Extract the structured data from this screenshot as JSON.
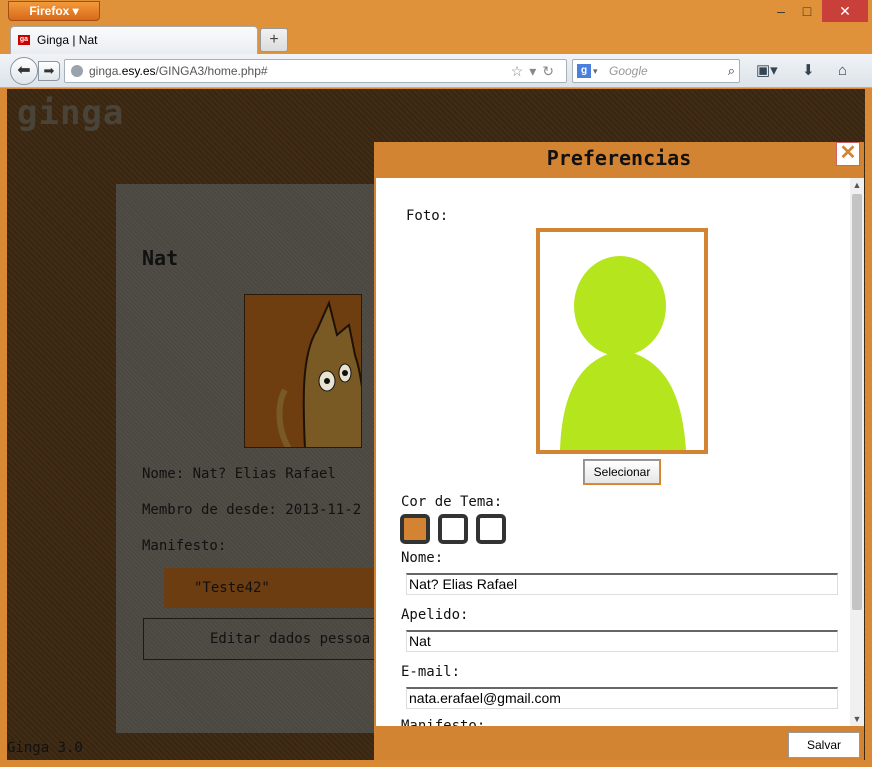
{
  "browser": {
    "menu_button": "Firefox",
    "tab_title": "Ginga | Nat",
    "tab_favicon": "ga",
    "new_tab": "+",
    "url_prefix": "ginga.",
    "url_host": "esy.es",
    "url_path": "/GINGA3/home.php#",
    "search_placeholder": "Google",
    "search_engine_letter": "g"
  },
  "page": {
    "logo": "ginga",
    "footer": "Ginga 3.0",
    "profile": {
      "name": "Nat",
      "nome_line": "Nome: Nat? Elias Rafael",
      "member_line": "Membro de desde: 2013-11-2",
      "manifesto_label": "Manifesto:",
      "manifesto_value": "\"Teste42\"",
      "edit_button": "Editar dados pessoa"
    }
  },
  "modal": {
    "title": "Preferencias",
    "close_glyph": "✕",
    "foto_label": "Foto:",
    "select_button": "Selecionar",
    "theme_label": "Cor de Tema:",
    "theme_swatches": [
      "#d38432",
      "#ffffff",
      "#ffffff"
    ],
    "nome_label": "Nome:",
    "nome_value": "Nat? Elias Rafael",
    "apelido_label": "Apelido:",
    "apelido_value": "Nat",
    "email_label": "E-mail:",
    "email_value": "nata.erafael@gmail.com",
    "manifesto_label": "Manifesto:",
    "save_button": "Salvar"
  },
  "colors": {
    "accent": "#d38432",
    "avatar": "#b5e51d",
    "page_bg": "#3a2610"
  }
}
